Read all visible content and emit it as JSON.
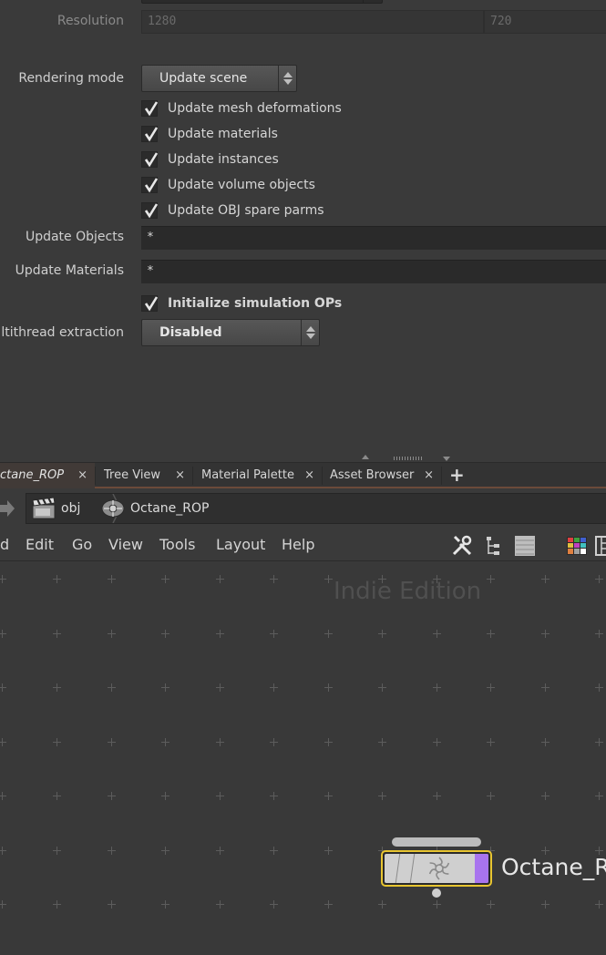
{
  "params": {
    "resolution": {
      "label": "Resolution",
      "x": "1280",
      "y": "720"
    },
    "rendering_mode": {
      "label": "Rendering mode",
      "value": "Update scene"
    },
    "checks": [
      {
        "label": "Update mesh deformations",
        "checked": true
      },
      {
        "label": "Update materials",
        "checked": true
      },
      {
        "label": "Update instances",
        "checked": true
      },
      {
        "label": "Update volume objects",
        "checked": true
      },
      {
        "label": "Update OBJ spare parms",
        "checked": true
      }
    ],
    "update_objects": {
      "label": "Update Objects",
      "value": "*"
    },
    "update_materials": {
      "label": "Update Materials",
      "value": "*"
    },
    "init_sim": {
      "label": "Initialize simulation OPs",
      "checked": true
    },
    "multithread": {
      "label": "ltithread extraction",
      "value": "Disabled"
    }
  },
  "tabs": [
    {
      "label": "ctane_ROP",
      "close": "×",
      "active": true
    },
    {
      "label": "Tree View",
      "close": "×"
    },
    {
      "label": "Material Palette",
      "close": "×"
    },
    {
      "label": "Asset Browser",
      "close": "×"
    }
  ],
  "tab_add": "+",
  "path": {
    "root": "obj",
    "current": "Octane_ROP"
  },
  "menu": [
    "d",
    "Edit",
    "Go",
    "View",
    "Tools",
    "Layout",
    "Help"
  ],
  "toolbar_icons": [
    "wrench-icon",
    "tree-icon",
    "list-icon",
    "color-palette-icon",
    "layout-icon"
  ],
  "network": {
    "watermark": "Indie Edition",
    "node": {
      "label": "Octane_RC",
      "type_icon": "octane-icon",
      "flag_color": "#a874ee",
      "selected_color": "#e8c530"
    }
  }
}
